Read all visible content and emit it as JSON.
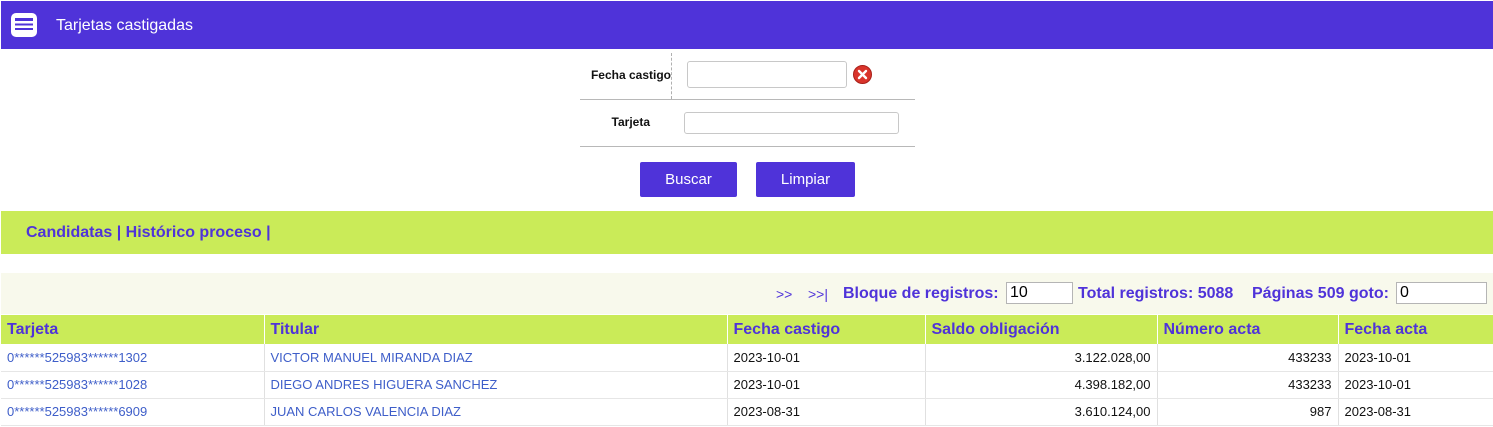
{
  "header": {
    "title": "Tarjetas castigadas",
    "icon": "form-list-icon",
    "bg_color": "#4f33d9"
  },
  "form": {
    "fecha_label": "Fecha castigo",
    "fecha_value": "",
    "tarjeta_label": "Tarjeta",
    "tarjeta_value": "",
    "buscar_label": "Buscar",
    "limpiar_label": "Limpiar"
  },
  "nav": {
    "links": [
      "Candidatas",
      "Histórico proceso"
    ],
    "separator": "|"
  },
  "pager": {
    "next": ">>",
    "last": ">>|",
    "bloque_label": "Bloque de registros:",
    "bloque_value": "10",
    "total_label": "Total registros: 5088",
    "paginas_label": "Páginas 509 goto:",
    "goto_value": "0"
  },
  "table": {
    "columns": [
      "Tarjeta",
      "Titular",
      "Fecha castigo",
      "Saldo obligación",
      "Número acta",
      "Fecha acta"
    ],
    "rows": [
      [
        "0******525983******1302",
        "VICTOR MANUEL MIRANDA DIAZ",
        "2023-10-01",
        "3.122.028,00",
        "433233",
        "2023-10-01"
      ],
      [
        "0******525983******1028",
        "DIEGO ANDRES HIGUERA SANCHEZ",
        "2023-10-01",
        "4.398.182,00",
        "433233",
        "2023-10-01"
      ],
      [
        "0******525983******6909",
        "JUAN CARLOS VALENCIA DIAZ",
        "2023-08-31",
        "3.610.124,00",
        "987",
        "2023-08-31"
      ]
    ]
  },
  "colors": {
    "accent": "#4f33d9",
    "band": "#caeb58",
    "link": "#3e5ec9",
    "clear": "#d9342b"
  }
}
